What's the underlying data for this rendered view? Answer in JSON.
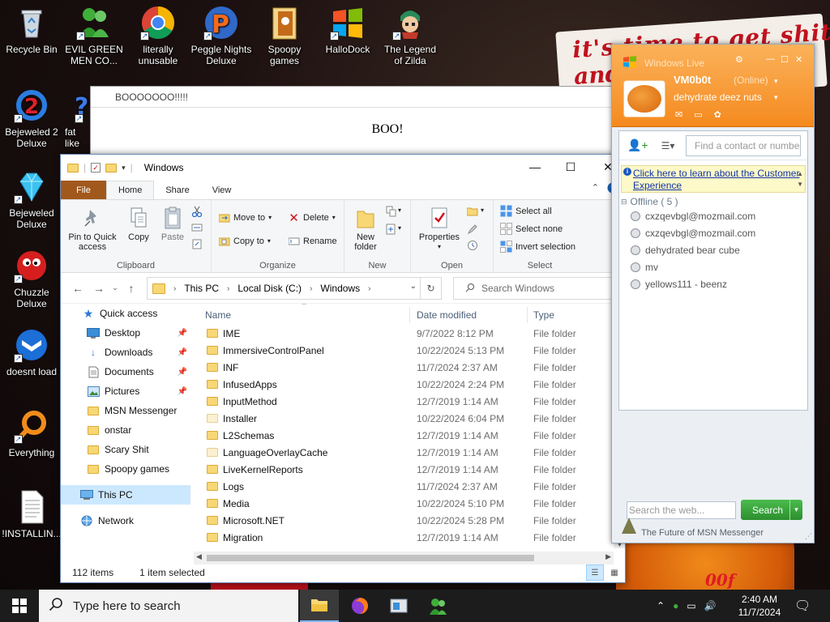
{
  "desktop": {
    "icons": [
      {
        "label": "Recycle Bin"
      },
      {
        "label": "EVIL GREEN MEN CO..."
      },
      {
        "label": "literally unusable"
      },
      {
        "label": "Peggle Nights Deluxe"
      },
      {
        "label": "Spoopy games"
      },
      {
        "label": "HalloDock"
      },
      {
        "label": "The Legend of Zilda"
      },
      {
        "label": "Bejeweled 2 Deluxe"
      },
      {
        "label": "fat like"
      },
      {
        "label": "Bejeweled Deluxe"
      },
      {
        "label": "Chuzzle Deluxe"
      },
      {
        "label": "doesnt load"
      },
      {
        "label": "Everything"
      },
      {
        "label": "!INSTALLIN..."
      }
    ],
    "wallpaper_text": [
      "it's time to get shit",
      "and"
    ],
    "wallpaper_bottom_text": "00f"
  },
  "boo_window": {
    "title": "BOOOOOOO!!!!!",
    "content": "BOO!"
  },
  "explorer": {
    "title": "Windows",
    "ribbon_tabs": [
      "File",
      "Home",
      "Share",
      "View"
    ],
    "ribbon": {
      "clipboard": {
        "pin": "Pin to Quick access",
        "copy": "Copy",
        "paste": "Paste",
        "label": "Clipboard"
      },
      "organize": {
        "move_to": "Move to",
        "copy_to": "Copy to",
        "delete": "Delete",
        "rename": "Rename",
        "label": "Organize"
      },
      "new": {
        "new_folder": "New folder",
        "label": "New"
      },
      "open": {
        "properties": "Properties",
        "label": "Open"
      },
      "select": {
        "select_all": "Select all",
        "select_none": "Select none",
        "invert": "Invert selection",
        "label": "Select"
      }
    },
    "address": {
      "crumbs": [
        "This PC",
        "Local Disk (C:)",
        "Windows"
      ]
    },
    "search": {
      "placeholder": "Search Windows"
    },
    "nav_pane": {
      "quick_access": "Quick access",
      "items": [
        {
          "label": "Desktop",
          "pinned": true
        },
        {
          "label": "Downloads",
          "pinned": true
        },
        {
          "label": "Documents",
          "pinned": true
        },
        {
          "label": "Pictures",
          "pinned": true
        },
        {
          "label": "MSN Messenger",
          "pinned": false
        },
        {
          "label": "onstar",
          "pinned": false
        },
        {
          "label": "Scary Shit",
          "pinned": false
        },
        {
          "label": "Spoopy games",
          "pinned": false
        }
      ],
      "this_pc": "This PC",
      "network": "Network"
    },
    "columns": {
      "name": "Name",
      "date": "Date modified",
      "type": "Type"
    },
    "files": [
      {
        "name": "IME",
        "date": "9/7/2022 8:12 PM",
        "type": "File folder",
        "light": false
      },
      {
        "name": "ImmersiveControlPanel",
        "date": "10/22/2024 5:13 PM",
        "type": "File folder",
        "light": false
      },
      {
        "name": "INF",
        "date": "11/7/2024 2:37 AM",
        "type": "File folder",
        "light": false
      },
      {
        "name": "InfusedApps",
        "date": "10/22/2024 2:24 PM",
        "type": "File folder",
        "light": false
      },
      {
        "name": "InputMethod",
        "date": "12/7/2019 1:14 AM",
        "type": "File folder",
        "light": false
      },
      {
        "name": "Installer",
        "date": "10/22/2024 6:04 PM",
        "type": "File folder",
        "light": true
      },
      {
        "name": "L2Schemas",
        "date": "12/7/2019 1:14 AM",
        "type": "File folder",
        "light": false
      },
      {
        "name": "LanguageOverlayCache",
        "date": "12/7/2019 1:14 AM",
        "type": "File folder",
        "light": true
      },
      {
        "name": "LiveKernelReports",
        "date": "12/7/2019 1:14 AM",
        "type": "File folder",
        "light": false
      },
      {
        "name": "Logs",
        "date": "11/7/2024 2:37 AM",
        "type": "File folder",
        "light": false
      },
      {
        "name": "Media",
        "date": "10/22/2024 5:10 PM",
        "type": "File folder",
        "light": false
      },
      {
        "name": "Microsoft.NET",
        "date": "10/22/2024 5:28 PM",
        "type": "File folder",
        "light": false
      },
      {
        "name": "Migration",
        "date": "12/7/2019 1:14 AM",
        "type": "File folder",
        "light": false
      }
    ],
    "status": {
      "items": "112 items",
      "selected": "1 item selected"
    }
  },
  "msn": {
    "title": "Windows Live",
    "name": "VM0b0t",
    "status": "(Online)",
    "personal_message": "dehydrate deez nuts",
    "find_placeholder": "Find a contact or numbe",
    "banner_link": "Click here to learn about the Customer Experience",
    "group": "Offline ( 5 )",
    "contacts": [
      "cxzqevbgl@mozmail.com",
      "cxzqevbgl@mozmail.com",
      "dehydrated bear cube",
      "mv",
      "yellows111 - beenz"
    ],
    "web_placeholder": "Search the web...",
    "search_button": "Search",
    "footer": "The Future of MSN Messenger"
  },
  "taskbar": {
    "search_placeholder": "Type here to search",
    "time": "2:40 AM",
    "date": "11/7/2024"
  },
  "colors": {
    "accent": "#1a5fb4",
    "file_tab": "#a1581c",
    "msn_orange": "#f58a1f",
    "taskbar": "#1c1c1c"
  }
}
